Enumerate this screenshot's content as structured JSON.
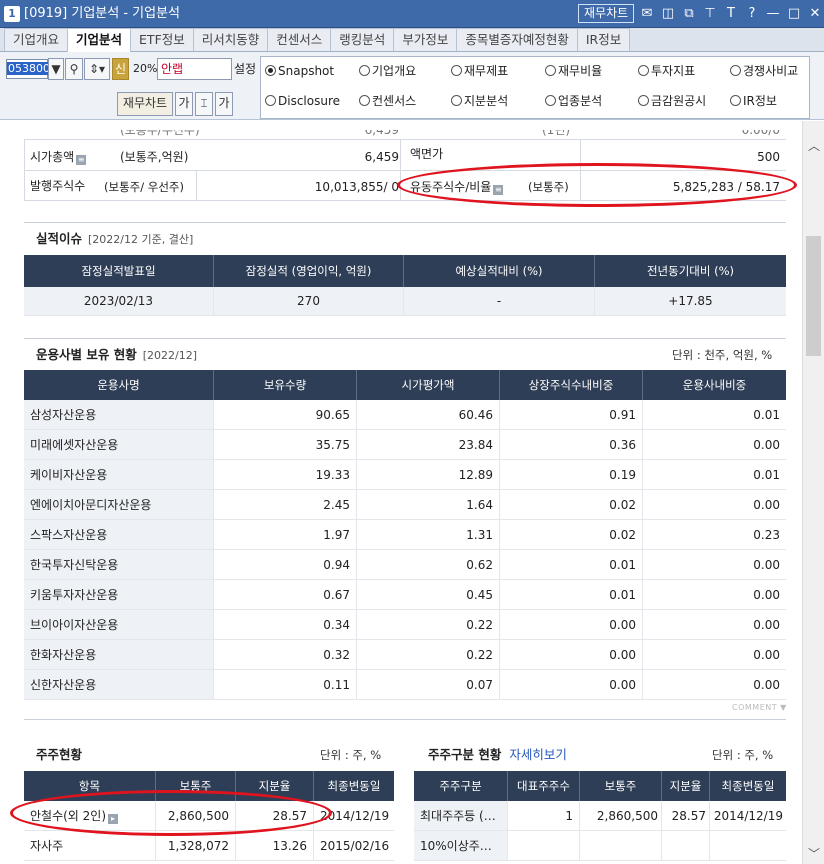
{
  "window": {
    "num": "1",
    "title": "[0919] 기업분석 - 기업분석",
    "fin_chart_button": "재무차트",
    "controls": [
      "✉",
      "◫",
      "⧉",
      "⊤",
      "T",
      "?",
      "—",
      "□",
      "✕"
    ]
  },
  "tabs": [
    "기업개요",
    "기업분석",
    "ETF정보",
    "리서치동향",
    "컨센서스",
    "랭킹분석",
    "부가정보",
    "종목별증자예정현황",
    "IR정보"
  ],
  "toolbar": {
    "code": "053800",
    "new_label": "신",
    "pct": "20%",
    "company": "안랩",
    "settings": "설정",
    "fin_chart": "재무차트",
    "ga1": "가",
    "ga2": "가"
  },
  "radios": [
    {
      "label": "Snapshot",
      "on": true
    },
    {
      "label": "기업개요",
      "on": false
    },
    {
      "label": "재무제표",
      "on": false
    },
    {
      "label": "재무비율",
      "on": false
    },
    {
      "label": "투자지표",
      "on": false
    },
    {
      "label": "경쟁사비교",
      "on": false
    },
    {
      "label": "Disclosure",
      "on": false
    },
    {
      "label": "컨센서스",
      "on": false
    },
    {
      "label": "지분분석",
      "on": false
    },
    {
      "label": "업종분석",
      "on": false
    },
    {
      "label": "금감원공시",
      "on": false
    },
    {
      "label": "IR정보",
      "on": false
    }
  ],
  "summary": {
    "partial_left": "(보통주/우선주)",
    "partial_left_val": "6,459",
    "partial_mid": "(1년)",
    "partial_right_val": "0.00/0",
    "mktcap_label": "시가총액",
    "mktcap_unit": "(보통주,억원)",
    "mktcap_val": "6,459",
    "face_label": "액면가",
    "face_val": "500",
    "shares_label": "발행주식수",
    "shares_unit": "(보통주/ 우선주)",
    "shares_val": "10,013,855/ 0",
    "float_label": "유동주식수/비율",
    "float_unit": "(보통주)",
    "float_val": "5,825,283 / 58.17"
  },
  "earnings": {
    "title": "실적이슈",
    "sub": "[2022/12 기준, 결산]",
    "headers": [
      "잠정실적발표일",
      "잠정실적 (영업이익, 억원)",
      "예상실적대비 (%)",
      "전년동기대비 (%)"
    ],
    "row": [
      "2023/02/13",
      "270",
      "-",
      "+17.85"
    ]
  },
  "funds": {
    "title": "운용사별 보유 현황",
    "sub": "[2022/12]",
    "unit": "단위 : 천주, 억원, %",
    "headers": [
      "운용사명",
      "보유수량",
      "시가평가액",
      "상장주식수내비중",
      "운용사내비중"
    ],
    "rows": [
      [
        "삼성자산운용",
        "90.65",
        "60.46",
        "0.91",
        "0.01"
      ],
      [
        "미래에셋자산운용",
        "35.75",
        "23.84",
        "0.36",
        "0.00"
      ],
      [
        "케이비자산운용",
        "19.33",
        "12.89",
        "0.19",
        "0.01"
      ],
      [
        "엔에이치아문디자산운용",
        "2.45",
        "1.64",
        "0.02",
        "0.00"
      ],
      [
        "스팍스자산운용",
        "1.97",
        "1.31",
        "0.02",
        "0.23"
      ],
      [
        "한국투자신탁운용",
        "0.94",
        "0.62",
        "0.01",
        "0.00"
      ],
      [
        "키움투자자산운용",
        "0.67",
        "0.45",
        "0.01",
        "0.00"
      ],
      [
        "브이아이자산운용",
        "0.34",
        "0.22",
        "0.00",
        "0.00"
      ],
      [
        "한화자산운용",
        "0.32",
        "0.22",
        "0.00",
        "0.00"
      ],
      [
        "신한자산운용",
        "0.11",
        "0.07",
        "0.00",
        "0.00"
      ]
    ],
    "comment": "COMMENT ▼"
  },
  "holders": {
    "title": "주주현황",
    "unit": "단위 : 주, %",
    "headers": [
      "항목",
      "보통주",
      "지분율",
      "최종변동일"
    ],
    "rows": [
      [
        "안철수(외 2인)",
        "2,860,500",
        "28.57",
        "2014/12/19"
      ],
      [
        "자사주",
        "1,328,072",
        "13.26",
        "2015/02/16"
      ]
    ]
  },
  "holder_types": {
    "title": "주주구분 현황",
    "link": "자세히보기",
    "unit": "단위 : 주, %",
    "headers": [
      "주주구분",
      "대표주주수",
      "보통주",
      "지분율",
      "최종변동일"
    ],
    "rows": [
      [
        "최대주주등 (…",
        "1",
        "2,860,500",
        "28.57",
        "2014/12/19"
      ],
      [
        "10%이상주…",
        "",
        "",
        "",
        ""
      ]
    ]
  },
  "colors": {
    "titlebar": "#3f6aa9",
    "table_header": "#2e3e56",
    "highlight": "#e0141e",
    "first_col": "#eef2f7"
  }
}
